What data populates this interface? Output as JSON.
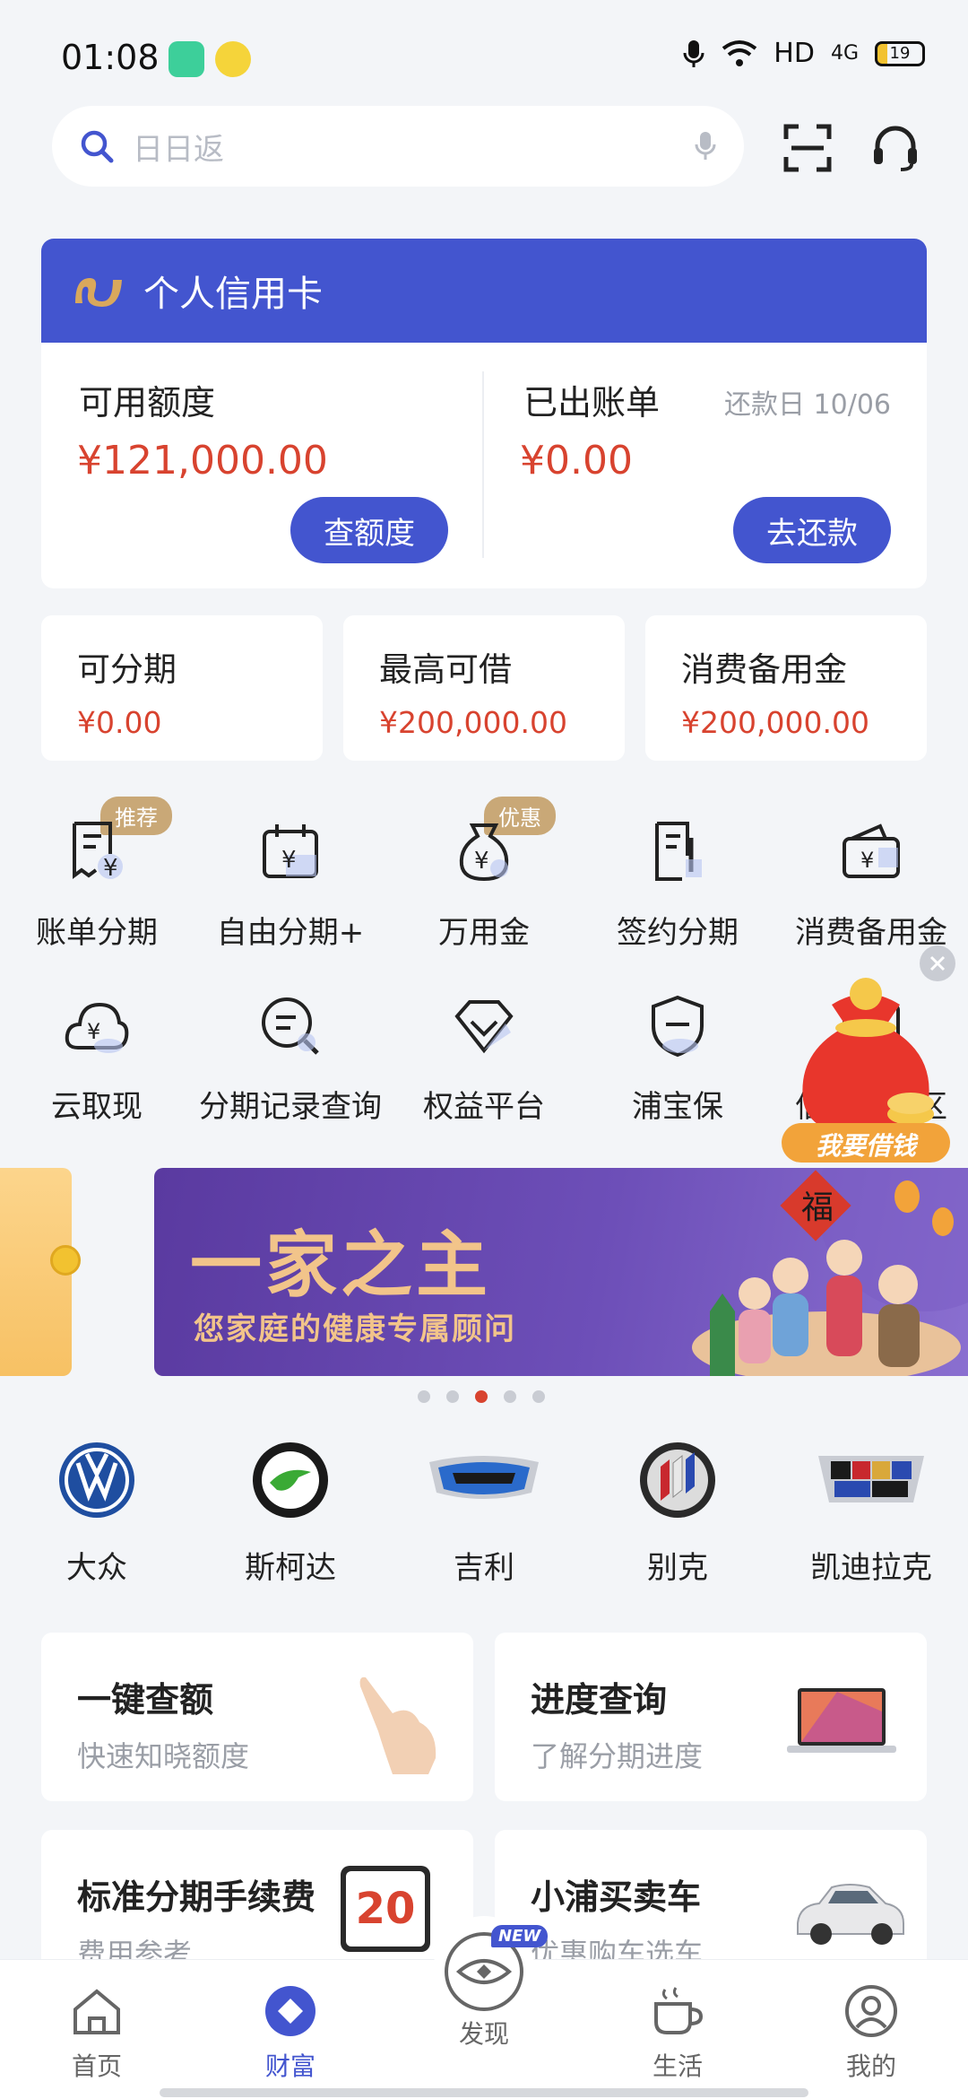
{
  "status_bar": {
    "time": "01:08",
    "network": "HD",
    "signal": "4G",
    "battery": "19"
  },
  "search": {
    "placeholder": "日日返"
  },
  "credit_card": {
    "title": "个人信用卡",
    "available_label": "可用额度",
    "available_amount": "¥121,000.00",
    "check_limit_button": "查额度",
    "billed_label": "已出账单",
    "due_date_text": "还款日 10/06",
    "billed_amount": "¥0.00",
    "repay_button": "去还款"
  },
  "summary_cards": [
    {
      "label": "可分期",
      "value": "¥0.00"
    },
    {
      "label": "最高可借",
      "value": "¥200,000.00"
    },
    {
      "label": "消费备用金",
      "value": "¥200,000.00"
    }
  ],
  "services_row1": [
    {
      "label": "账单分期",
      "icon": "bill-installment-icon",
      "tag": "推荐"
    },
    {
      "label": "自由分期+",
      "icon": "calendar-yen-icon"
    },
    {
      "label": "万用金",
      "icon": "money-bag-icon",
      "tag": "优惠"
    },
    {
      "label": "签约分期",
      "icon": "contract-icon"
    },
    {
      "label": "消费备用金",
      "icon": "wallet-icon"
    }
  ],
  "services_row2": [
    {
      "label": "云取现",
      "icon": "cloud-cash-icon"
    },
    {
      "label": "分期记录查询",
      "icon": "record-search-icon"
    },
    {
      "label": "权益平台",
      "icon": "rights-icon"
    },
    {
      "label": "浦宝保",
      "icon": "shield-icon"
    },
    {
      "label": "信用卡专区",
      "icon": "card-zone-icon"
    }
  ],
  "floating_ad": {
    "label": "我要借钱"
  },
  "banner": {
    "headline": "一家之主",
    "subline": "您家庭的健康专属顾问",
    "pages": 5,
    "active_page": 3
  },
  "brands": [
    {
      "label": "大众",
      "icon": "vw-logo"
    },
    {
      "label": "斯柯达",
      "icon": "skoda-logo"
    },
    {
      "label": "吉利",
      "icon": "geely-logo"
    },
    {
      "label": "别克",
      "icon": "buick-logo"
    },
    {
      "label": "凯迪拉克",
      "icon": "cadillac-logo"
    }
  ],
  "features": [
    {
      "title": "一键查额",
      "subtitle": "快速知晓额度"
    },
    {
      "title": "进度查询",
      "subtitle": "了解分期进度"
    },
    {
      "title": "标准分期手续费",
      "subtitle": "费用参考",
      "badge": "20"
    },
    {
      "title": "小浦买卖车",
      "subtitle": "优惠购车选车"
    }
  ],
  "tabbar": {
    "items": [
      {
        "label": "首页",
        "icon": "home-icon"
      },
      {
        "label": "财富",
        "icon": "wealth-icon"
      },
      {
        "label": "发现",
        "icon": "discover-icon",
        "badge": "NEW"
      },
      {
        "label": "生活",
        "icon": "coffee-icon"
      },
      {
        "label": "我的",
        "icon": "profile-icon"
      }
    ],
    "active": "财富"
  },
  "colors": {
    "primary": "#4355cf",
    "amount_red": "#d8432f",
    "gold": "#c9a877"
  }
}
